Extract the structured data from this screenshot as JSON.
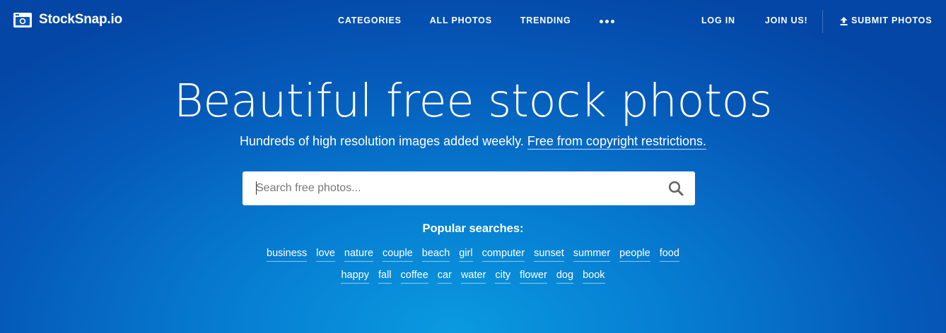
{
  "brand": {
    "name": "StockSnap.io"
  },
  "nav": {
    "center_links": [
      "CATEGORIES",
      "ALL PHOTOS",
      "TRENDING"
    ],
    "more_icon": "ellipsis-icon",
    "login": "LOG IN",
    "join": "JOIN US!",
    "submit": "SUBMIT PHOTOS",
    "submit_icon": "upload-icon"
  },
  "hero": {
    "headline": "Beautiful free stock photos",
    "subline_text": "Hundreds of high resolution images added weekly.",
    "subline_link": "Free from copyright restrictions."
  },
  "search": {
    "placeholder": "Search free photos...",
    "value": "",
    "icon": "search-icon"
  },
  "popular": {
    "title": "Popular searches:",
    "row1": [
      "business",
      "love",
      "nature",
      "couple",
      "beach",
      "girl",
      "computer",
      "sunset",
      "summer",
      "people",
      "food"
    ],
    "row2": [
      "happy",
      "fall",
      "coffee",
      "car",
      "water",
      "city",
      "flower",
      "dog",
      "book"
    ]
  },
  "colors": {
    "background_top": "#0446a6",
    "background_center": "#0a9ae0",
    "text": "#ffffff",
    "search_bg": "#ffffff",
    "search_icon": "#666666"
  }
}
